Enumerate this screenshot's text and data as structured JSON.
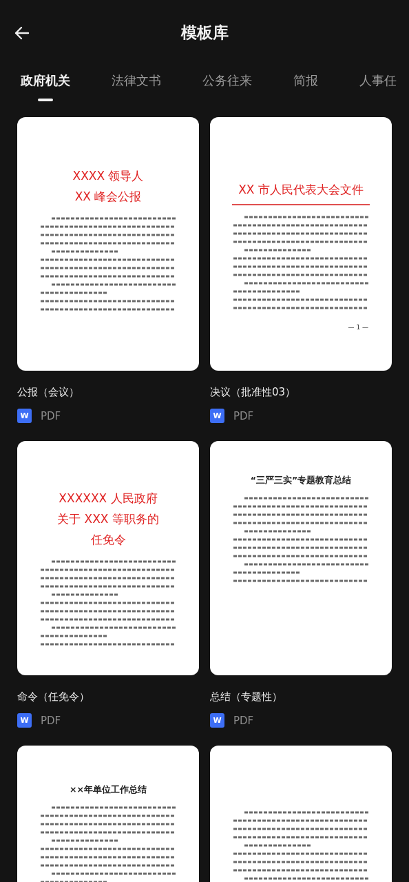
{
  "header": {
    "title": "模板库"
  },
  "tabs": [
    {
      "label": "政府机关",
      "selected": true
    },
    {
      "label": "法律文书",
      "selected": false
    },
    {
      "label": "公务往来",
      "selected": false
    },
    {
      "label": "简报",
      "selected": false
    },
    {
      "label": "人事任",
      "selected": false
    }
  ],
  "templates": [
    {
      "name": "公报（会议）",
      "badge": "W",
      "format": "PDF",
      "doc": {
        "kind": "red-title",
        "title_lines": [
          "XXXX 领导人",
          "XX 峰会公报"
        ]
      }
    },
    {
      "name": "决议（批准性03）",
      "badge": "W",
      "format": "PDF",
      "doc": {
        "kind": "letterhead",
        "title_lines": [
          "XX 市人民代表大会文件"
        ],
        "page_number": "— 1 —"
      }
    },
    {
      "name": "命令（任免令）",
      "badge": "W",
      "format": "PDF",
      "doc": {
        "kind": "red-title",
        "title_lines": [
          "XXXXXX 人民政府",
          "关于 XXX 等职务的",
          "任免令"
        ]
      }
    },
    {
      "name": "总结（专题性）",
      "badge": "W",
      "format": "PDF",
      "doc": {
        "kind": "plain",
        "title_lines": [
          "“三严三实”专题教育总结"
        ]
      }
    },
    {
      "doc": {
        "kind": "plain",
        "title_lines": [
          "××年单位工作总结"
        ]
      }
    },
    {
      "doc": {
        "kind": "plain"
      }
    }
  ]
}
